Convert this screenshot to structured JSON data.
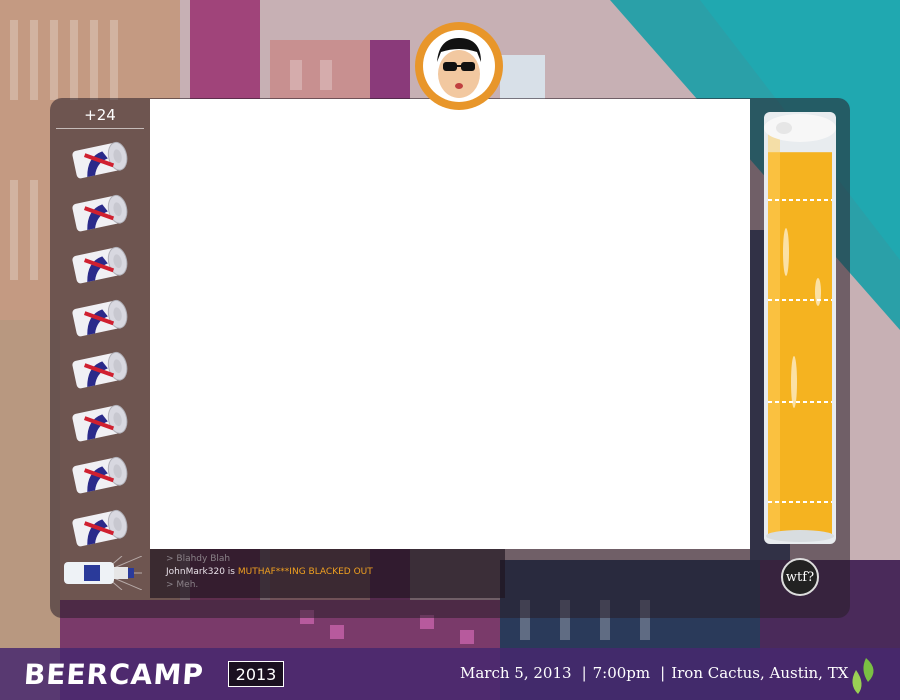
{
  "game": {
    "score": "+24",
    "cans_remaining": 8,
    "beer_fill_level": 0.95
  },
  "log": {
    "line1": "> Blahdy Blah",
    "line2_user": "JohnMark320 is ",
    "line2_status": "MUTHAF***ING BLACKED OUT",
    "line3": "> Meh."
  },
  "buttons": {
    "wtf": "wtf?"
  },
  "footer": {
    "logo": "BEERCAMP",
    "year": "2013",
    "date": "March 5, 2013",
    "time": "7:00pm",
    "venue": "Iron Cactus, Austin, TX"
  },
  "colors": {
    "footer_bg": "#46286e",
    "beer": "#f5b320",
    "avatar_ring": "#e8962a",
    "highlight": "#f0a020"
  }
}
